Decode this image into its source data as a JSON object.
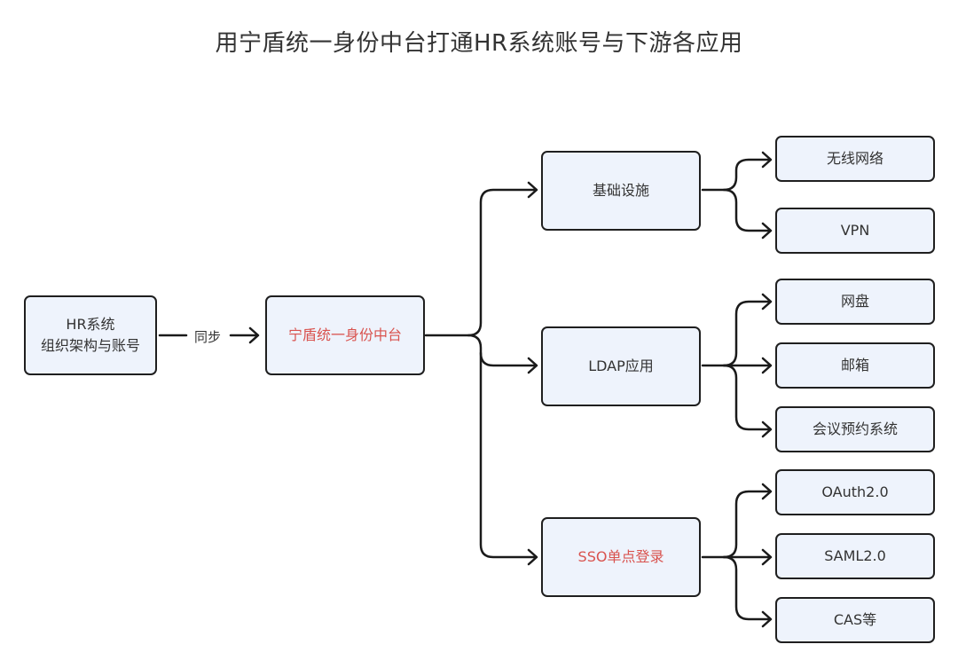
{
  "title": "用宁盾统一身份中台打通HR系统账号与下游各应用",
  "accent_color": "#d9534f",
  "nodes": {
    "hr": {
      "line1": "HR系统",
      "line2": "组织架构与账号"
    },
    "hub": "宁盾统一身份中台",
    "infra": "基础设施",
    "ldap": "LDAP应用",
    "sso": "SSO单点登录",
    "wifi": "无线网络",
    "vpn": "VPN",
    "disk": "网盘",
    "mail": "邮箱",
    "meeting": "会议预约系统",
    "oauth": "OAuth2.0",
    "saml": "SAML2.0",
    "cas": "CAS等"
  },
  "edge_label_sync": "同步"
}
